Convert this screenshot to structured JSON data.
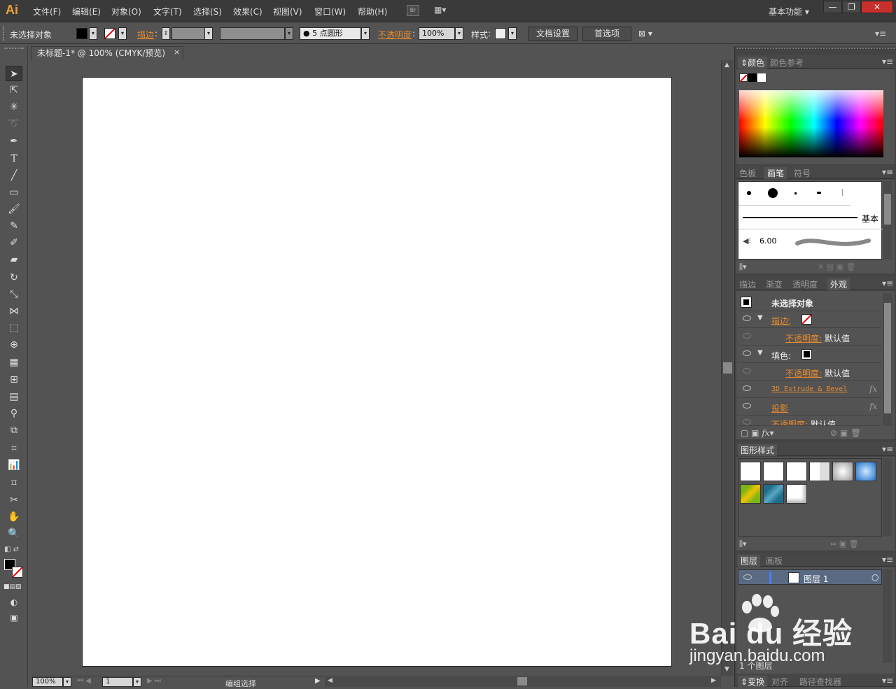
{
  "app": {
    "logo": "Ai"
  },
  "menu": {
    "items": [
      "文件(F)",
      "编辑(E)",
      "对象(O)",
      "文字(T)",
      "选择(S)",
      "效果(C)",
      "视图(V)",
      "窗口(W)",
      "帮助(H)"
    ],
    "bridge": "Br",
    "workspace": "基本功能"
  },
  "control": {
    "selection": "未选择对象",
    "stroke_label": "描边",
    "brush_size": "5",
    "brush_name": "点圆形",
    "opacity_label": "不透明度",
    "opacity_value": "100%",
    "style_label": "样式",
    "doc_setup": "文档设置",
    "preferences": "首选项"
  },
  "document": {
    "tab_title": "未标题-1* @ 100% (CMYK/预览)",
    "close": "×"
  },
  "status": {
    "zoom": "100%",
    "artboard": "1",
    "tool_status": "编组选择"
  },
  "panels": {
    "color_tabs": [
      "颜色",
      "颜色参考"
    ],
    "brush_tabs": [
      "色板",
      "画笔",
      "符号"
    ],
    "brush_basic": "基本",
    "brush_size": "6.00",
    "appearance_tabs": [
      "描边",
      "渐变",
      "透明度",
      "外观"
    ],
    "appearance": {
      "title": "未选择对象",
      "stroke": "描边:",
      "opacity1": "不透明度:",
      "default1": "默认值",
      "fill": "填色:",
      "opacity2": "不透明度:",
      "default2": "默认值",
      "effect1": "3D Extrude & Bevel",
      "effect2": "投影",
      "opacity3": "不透明度:",
      "default3": "默认值"
    },
    "graphic_styles_title": "图形样式",
    "layers_tabs": [
      "图层",
      "画板"
    ],
    "layer_name": "图层 1",
    "layer_count": "1 个图层",
    "bottom_tabs": [
      "变换",
      "对齐",
      "路径查找器"
    ]
  },
  "watermark": {
    "brand": "Bai du 经验",
    "url": "jingyan.baidu.com"
  },
  "colors": {
    "accent_orange": "#e68a2e",
    "ui_dark": "#535353"
  }
}
